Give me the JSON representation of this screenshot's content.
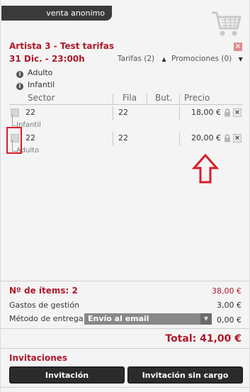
{
  "header": {
    "user_label": "venta anonimo"
  },
  "event": {
    "title": "Artista  3 - Test tarifas",
    "date": "31 Dic. - 23:00h"
  },
  "filters": {
    "tarifas_label": "Tarifas (2)",
    "promociones_label": "Promociones (0)"
  },
  "rates": [
    "Adulto",
    "Infantil"
  ],
  "table": {
    "headers": [
      "Sector",
      "Fila",
      "But.",
      "Precio"
    ],
    "rows": [
      {
        "sector": "22",
        "fila": "22",
        "butaca": "",
        "precio": "18,00 €",
        "tarifa": "Infantil"
      },
      {
        "sector": "22",
        "fila": "22",
        "butaca": "",
        "precio": "20,00 €",
        "tarifa": "Adulto"
      }
    ]
  },
  "summary": {
    "items_label": "Nº de ítems: 2",
    "items_value": "38,00 €",
    "fees_label": "Gastos de gestión",
    "fees_value": "3,00 €",
    "delivery_label": "Método de entrega",
    "delivery_selected": "Envío al email",
    "delivery_value": "0,00 €",
    "total": "Total: 41,00 €"
  },
  "invitations": {
    "title": "Invitaciones",
    "btn_invitation": "Invitación",
    "btn_invitation_free": "Invitación sin cargo"
  },
  "colors": {
    "accent": "#b0182a",
    "annotation": "#d71e2a",
    "dark": "#2b2b2b"
  },
  "icons": [
    "shopping-cart-icon",
    "close-icon",
    "info-icon",
    "lock-icon",
    "delete-icon",
    "up-arrow-annotation-icon",
    "chevron-down-icon"
  ]
}
